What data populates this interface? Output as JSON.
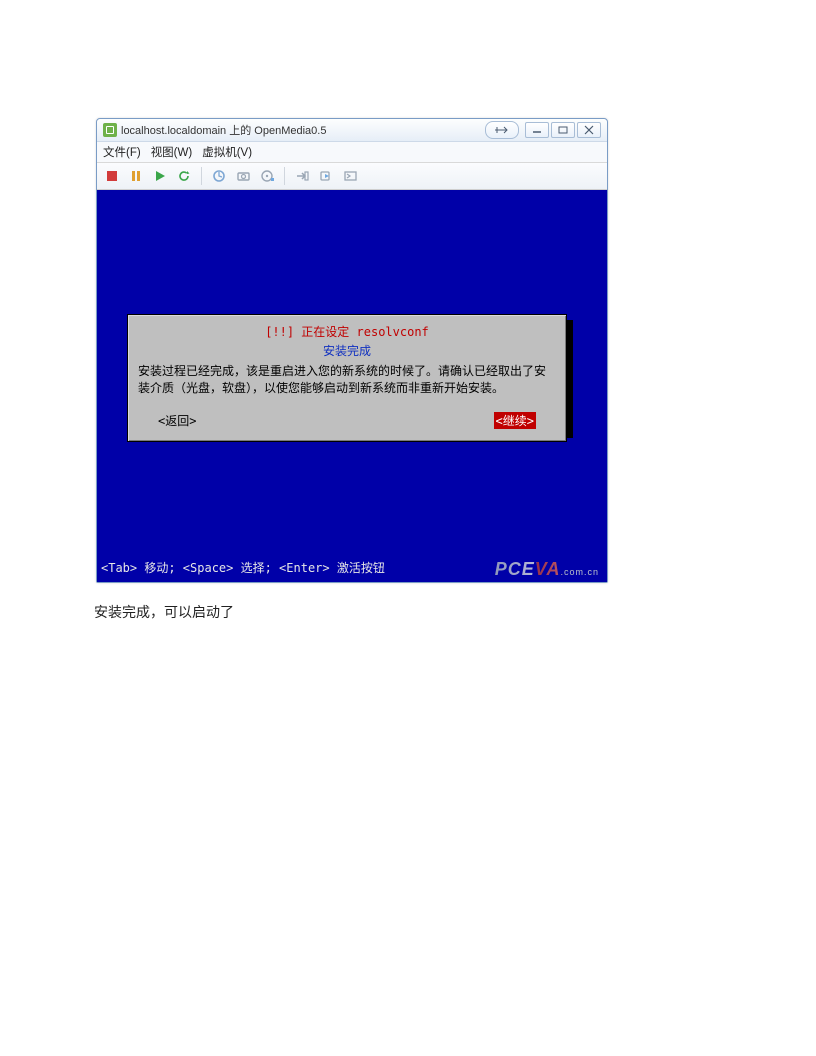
{
  "window": {
    "title": "localhost.localdomain 上的 OpenMedia0.5"
  },
  "menu": {
    "file": "文件(F)",
    "view": "视图(W)",
    "vm": "虚拟机(V)"
  },
  "toolbar_icons": {
    "stop": "stop-icon",
    "pause": "pause-icon",
    "play": "play-icon",
    "refresh": "refresh-icon",
    "snapshot": "snapshot-icon",
    "screenshot": "screenshot-icon",
    "cdrom": "cdrom-icon",
    "grab": "grab-icon",
    "send": "send-icon",
    "fullscreen": "fullscreen-icon"
  },
  "dialog": {
    "title": "[!!] 正在设定 resolvconf",
    "subtitle": "安装完成",
    "body": "安装过程已经完成，该是重启进入您的新系统的时候了。请确认已经取出了安装介质（光盘，软盘），以使您能够启动到新系统而非重新开始安装。",
    "back": "<返回>",
    "continue": "<继续>"
  },
  "hintbar": "<Tab> 移动; <Space> 选择; <Enter> 激活按钮",
  "watermark": {
    "main": "PCEVA",
    "tail": ".com.cn"
  },
  "caption": "安装完成，可以启动了"
}
